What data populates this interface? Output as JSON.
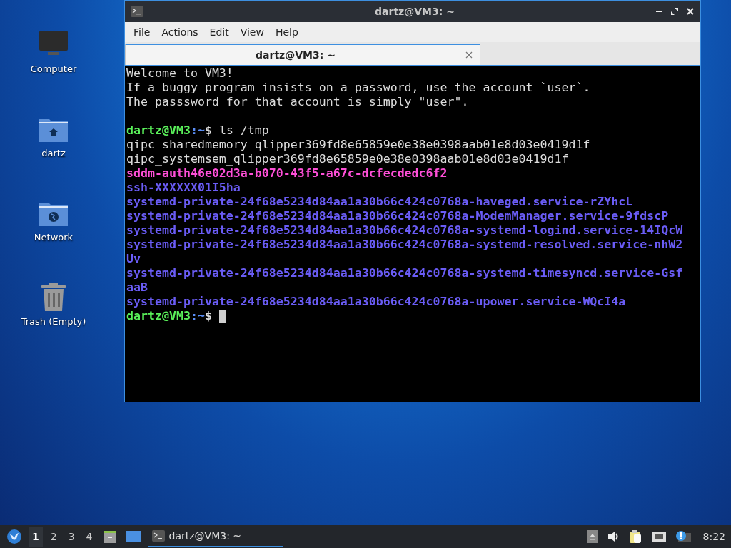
{
  "desktop_icons": [
    {
      "kind": "computer",
      "label": "Computer"
    },
    {
      "kind": "home",
      "label": "dartz"
    },
    {
      "kind": "network",
      "label": "Network"
    },
    {
      "kind": "trash",
      "label": "Trash (Empty)"
    }
  ],
  "window": {
    "title": "dartz@VM3: ~",
    "menu": [
      "File",
      "Actions",
      "Edit",
      "View",
      "Help"
    ],
    "tabs": [
      {
        "label": "dartz@VM3: ~",
        "selected": true
      }
    ],
    "terminal": [
      {
        "kind": "plain",
        "text": "Welcome to VM3!"
      },
      {
        "kind": "plain",
        "text": "If a buggy program insists on a password, use the account `user`."
      },
      {
        "kind": "plain",
        "text": "The passsword for that account is simply \"user\"."
      },
      {
        "kind": "blank"
      },
      {
        "kind": "prompt",
        "user": "dartz@VM3",
        "path": ":~",
        "symbol": "$",
        "command": "ls /tmp"
      },
      {
        "kind": "plain",
        "text": "qipc_sharedmemory_qlipper369fd8e65859e0e38e0398aab01e8d03e0419d1f"
      },
      {
        "kind": "plain",
        "text": "qipc_systemsem_qlipper369fd8e65859e0e38e0398aab01e8d03e0419d1f"
      },
      {
        "kind": "socket",
        "text": "sddm-auth46e02d3a-b070-43f5-a67c-dcfecdedc6f2"
      },
      {
        "kind": "directory",
        "text": "ssh-XXXXXX01I5ha"
      },
      {
        "kind": "directory",
        "text": "systemd-private-24f68e5234d84aa1a30b66c424c0768a-haveged.service-rZYhcL"
      },
      {
        "kind": "directory",
        "text": "systemd-private-24f68e5234d84aa1a30b66c424c0768a-ModemManager.service-9fdscP"
      },
      {
        "kind": "directory",
        "text": "systemd-private-24f68e5234d84aa1a30b66c424c0768a-systemd-logind.service-14IQcW"
      },
      {
        "kind": "directory",
        "text": "systemd-private-24f68e5234d84aa1a30b66c424c0768a-systemd-resolved.service-nhW2"
      },
      {
        "kind": "directory",
        "text": "Uv"
      },
      {
        "kind": "directory",
        "text": "systemd-private-24f68e5234d84aa1a30b66c424c0768a-systemd-timesyncd.service-Gsf"
      },
      {
        "kind": "directory",
        "text": "aaB"
      },
      {
        "kind": "directory",
        "text": "systemd-private-24f68e5234d84aa1a30b66c424c0768a-upower.service-WQcI4a"
      },
      {
        "kind": "prompt",
        "user": "dartz@VM3",
        "path": ":~",
        "symbol": "$",
        "cursor": true
      }
    ]
  },
  "taskbar": {
    "workspaces": [
      {
        "label": "1",
        "selected": true
      },
      {
        "label": "2",
        "selected": false
      },
      {
        "label": "3",
        "selected": false
      },
      {
        "label": "4",
        "selected": false
      }
    ],
    "tasks": [
      {
        "label": "dartz@VM3: ~",
        "selected": true
      }
    ],
    "clock": "8:22"
  }
}
